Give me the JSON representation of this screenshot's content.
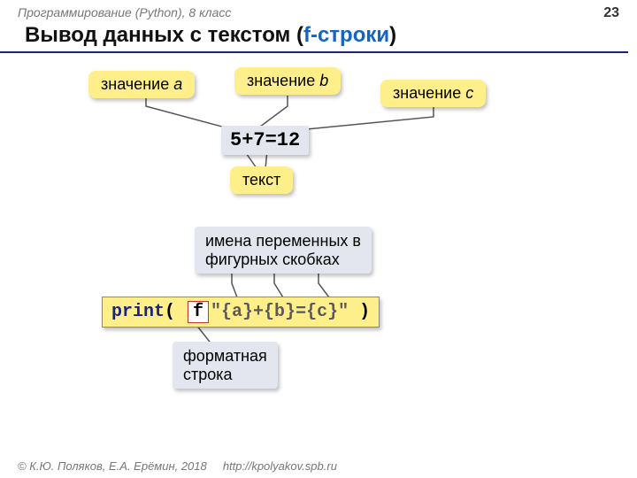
{
  "header": {
    "course": "Программирование (Python), 8 класс",
    "page": "23"
  },
  "title": {
    "black": "Вывод данных с текстом (",
    "blue": "f-строки",
    "black2": ")"
  },
  "callouts": {
    "val_a_pre": "значение ",
    "val_a_var": "a",
    "val_b_pre": "значение ",
    "val_b_var": "b",
    "val_c_pre": "значение ",
    "val_c_var": "c",
    "text": "текст",
    "vars_in_braces_l1": "имена переменных в",
    "vars_in_braces_l2": "фигурных скобках",
    "format_l1": "форматная",
    "format_l2": "строка"
  },
  "output": "5+7=12",
  "code": {
    "print": "print",
    "open": "( ",
    "f": "f",
    "str": "\"{a}+{b}={c}\"",
    "close": " )"
  },
  "footer": {
    "copyright": "© К.Ю. Поляков, Е.А. Ерёмин, 2018",
    "url": "http://kpolyakov.spb.ru"
  }
}
